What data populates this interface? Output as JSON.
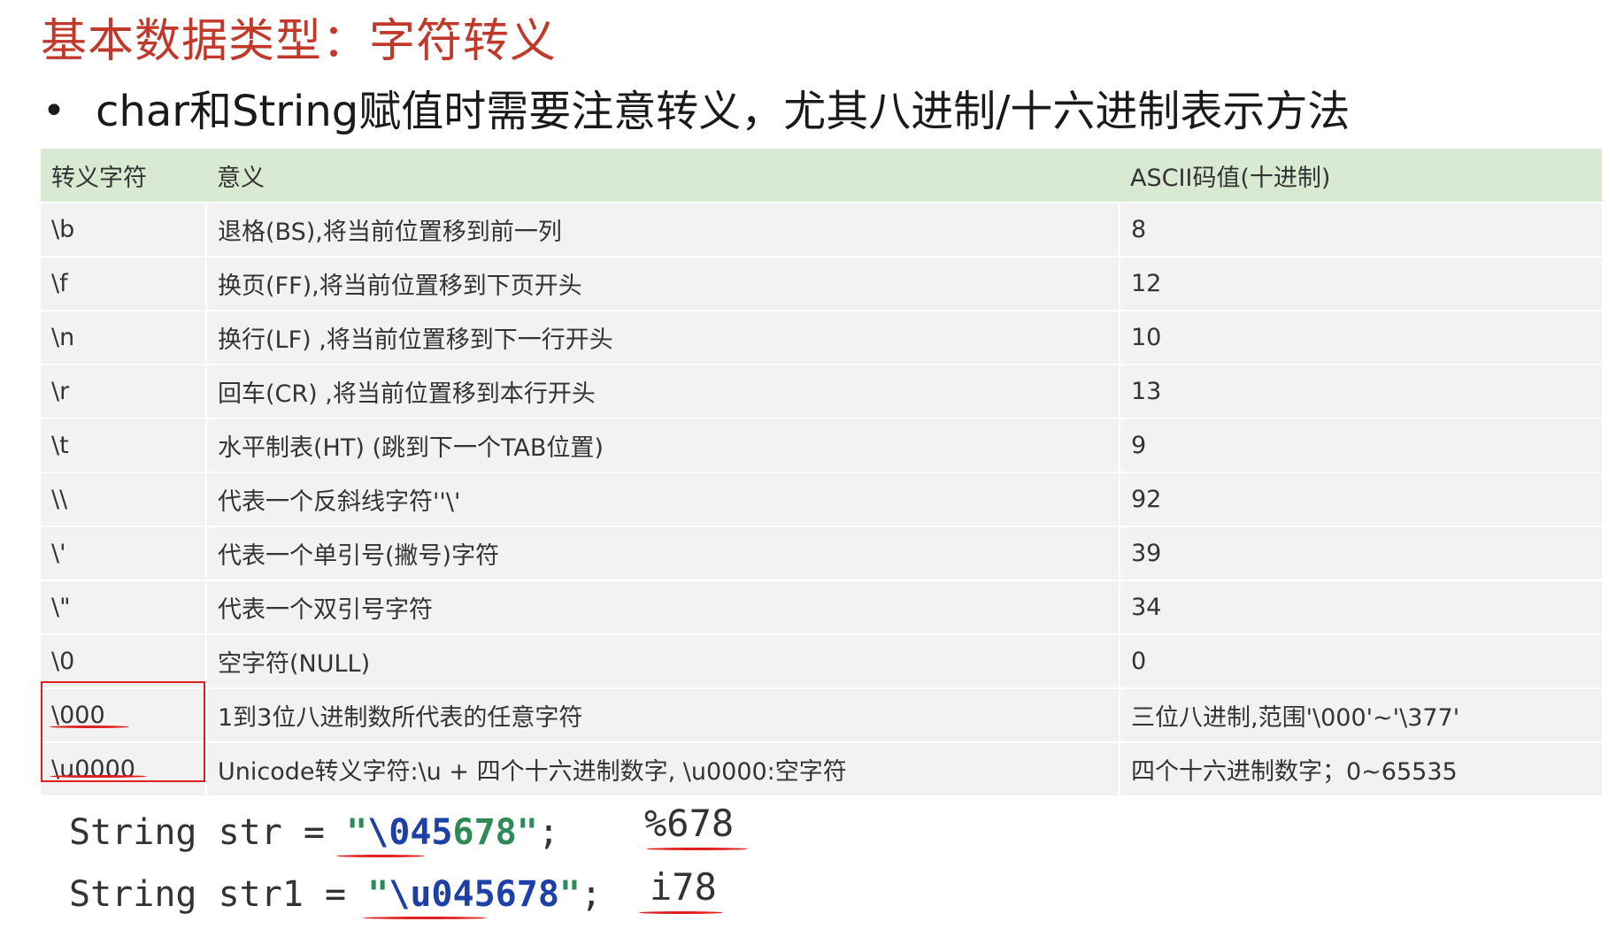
{
  "title": "基本数据类型：字符转义",
  "bullet": "char和String赋值时需要注意转义，尤其八进制/十六进制表示方法",
  "table": {
    "headers": [
      "转义字符",
      "意义",
      "ASCII码值(十进制)"
    ],
    "rows": [
      [
        "\\b",
        "退格(BS),将当前位置移到前一列",
        "8"
      ],
      [
        "\\f",
        "换页(FF),将当前位置移到下页开头",
        "12"
      ],
      [
        "\\n",
        "换行(LF) ,将当前位置移到下一行开头",
        "10"
      ],
      [
        "\\r",
        "回车(CR) ,将当前位置移到本行开头",
        "13"
      ],
      [
        "\\t",
        "水平制表(HT) (跳到下一个TAB位置)",
        "9"
      ],
      [
        "\\\\",
        "代表一个反斜线字符''\\'",
        "92"
      ],
      [
        "\\'",
        "代表一个单引号(撇号)字符",
        "39"
      ],
      [
        "\\\"",
        "代表一个双引号字符",
        "34"
      ],
      [
        "\\0",
        "空字符(NULL)",
        "0"
      ],
      [
        "\\000",
        "1到3位八进制数所代表的任意字符",
        "三位八进制,范围'\\000'~'\\377'"
      ],
      [
        "\\u0000",
        "Unicode转义字符:\\u + 四个十六进制数字, \\u0000:空字符",
        "四个十六进制数字；0~65535"
      ]
    ]
  },
  "examples": [
    {
      "prefix": "String str = ",
      "quote_open": "\"",
      "escape": "\\045",
      "rest": "678",
      "quote_close": "\"",
      "semicolon": ";",
      "result": "%678"
    },
    {
      "prefix": "String str1 = ",
      "quote_open": "\"",
      "escape": "\\u045678",
      "rest": "",
      "quote_close": "\"",
      "semicolon": ";",
      "result": "i78"
    }
  ],
  "colors": {
    "title": "#c0392b",
    "header_bg": "#d9ead3",
    "row_bg": "#f2f2f2",
    "annotation": "#e02020"
  }
}
